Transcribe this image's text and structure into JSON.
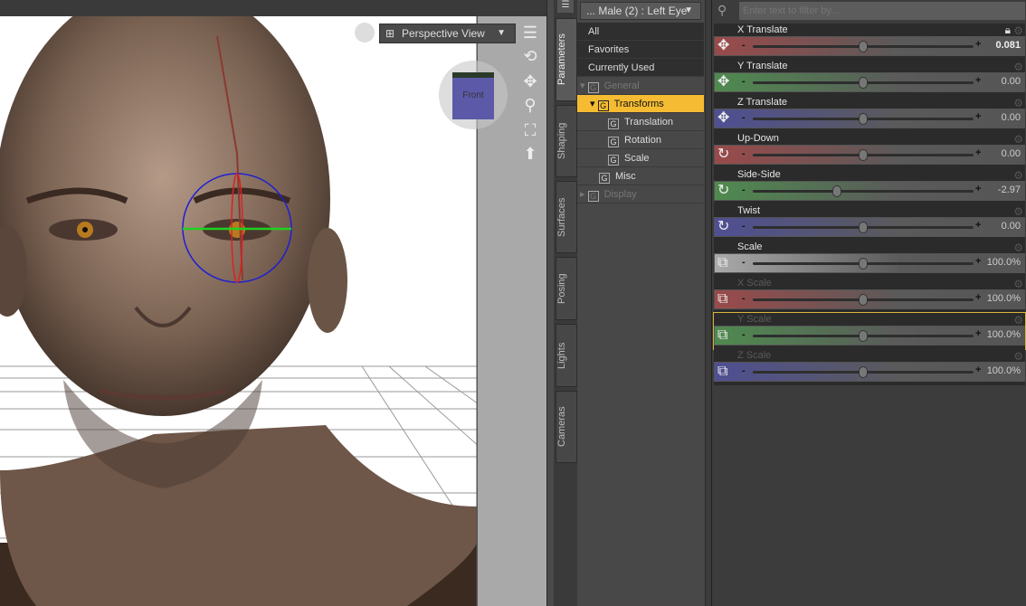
{
  "viewport": {
    "view_label": "Perspective View",
    "cube_label": "Front",
    "tools": [
      "view-menu-icon",
      "orbit-icon",
      "pan-icon",
      "zoom-icon",
      "frame-icon",
      "home-icon"
    ]
  },
  "tabs": [
    "Parameters",
    "Shaping",
    "Surfaces",
    "Posing",
    "Lights",
    "Cameras"
  ],
  "groups": {
    "node_selector": "... Male (2) : Left Eye",
    "items": [
      {
        "label": "All"
      },
      {
        "label": "Favorites"
      },
      {
        "label": "Currently Used"
      },
      {
        "label": "General"
      },
      {
        "label": "Transforms"
      },
      {
        "label": "Translation"
      },
      {
        "label": "Rotation"
      },
      {
        "label": "Scale"
      },
      {
        "label": "Misc"
      },
      {
        "label": "Display"
      }
    ]
  },
  "params": {
    "filter_placeholder": "Enter text to filter by...",
    "rows": [
      {
        "label": "X Translate",
        "value": "0.081",
        "pos": 0.5,
        "color": "#9a4a4a",
        "icon": "move-icon"
      },
      {
        "label": "Y Translate",
        "value": "0.00",
        "pos": 0.5,
        "color": "#4f8a4f",
        "icon": "move-icon"
      },
      {
        "label": "Z Translate",
        "value": "0.00",
        "pos": 0.5,
        "color": "#4f4f94",
        "icon": "move-icon"
      },
      {
        "label": "Up-Down",
        "value": "0.00",
        "pos": 0.5,
        "color": "#9a4a4a",
        "icon": "rotate-icon"
      },
      {
        "label": "Side-Side",
        "value": "-2.97",
        "pos": 0.38,
        "color": "#4f8a4f",
        "icon": "rotate-icon"
      },
      {
        "label": "Twist",
        "value": "0.00",
        "pos": 0.5,
        "color": "#4f4f94",
        "icon": "rotate-icon"
      },
      {
        "label": "Scale",
        "value": "100.0%",
        "pos": 0.5,
        "color": "#aaaaaa",
        "icon": "scale-icon"
      },
      {
        "label": "X Scale",
        "value": "100.0%",
        "pos": 0.5,
        "color": "#9a4a4a",
        "icon": "scale-icon"
      },
      {
        "label": "Y Scale",
        "value": "100.0%",
        "pos": 0.5,
        "color": "#4f8a4f",
        "icon": "scale-icon"
      },
      {
        "label": "Z Scale",
        "value": "100.0%",
        "pos": 0.5,
        "color": "#4f4f94",
        "icon": "scale-icon"
      }
    ]
  }
}
